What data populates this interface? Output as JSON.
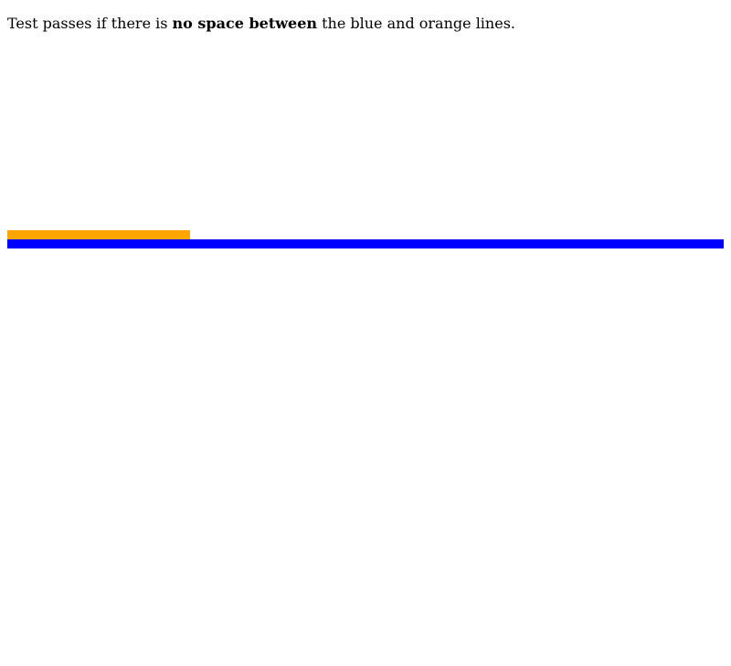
{
  "instructions": {
    "prefix": "Test passes if there is ",
    "emphasis": "no space between",
    "suffix": " the blue and orange lines."
  },
  "colors": {
    "orange_line": "#ffa500",
    "blue_line": "#0000ff",
    "background": "#ffffff"
  }
}
